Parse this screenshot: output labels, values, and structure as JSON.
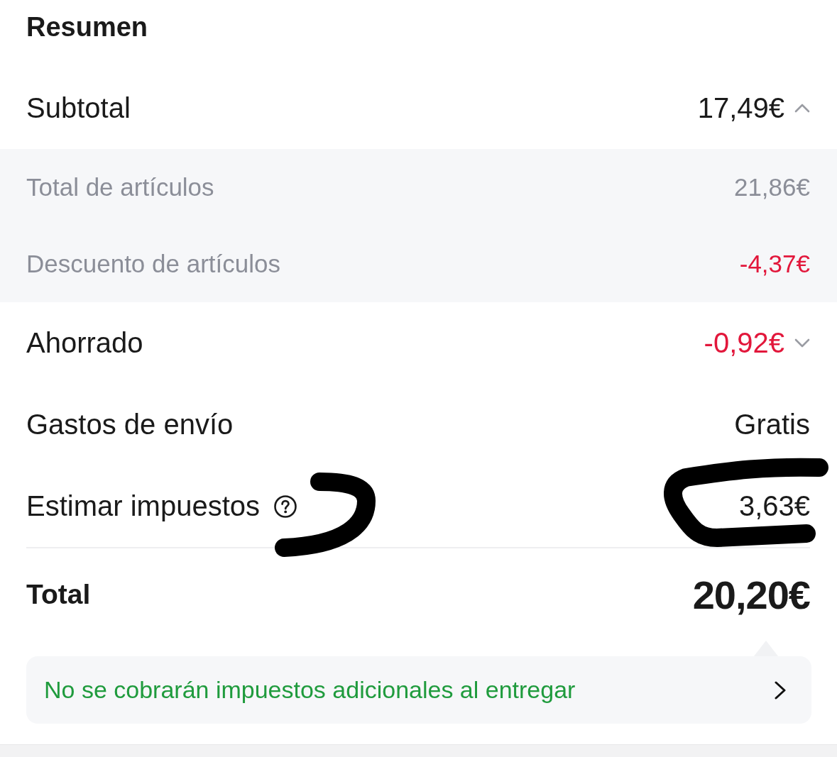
{
  "title": "Resumen",
  "rows": [
    {
      "label": "Subtotal",
      "value": "17,49€",
      "kind": "toggle",
      "expanded": true,
      "discount": false,
      "children": [
        {
          "label": "Total de artículos",
          "value": "21,86€",
          "discount": false
        },
        {
          "label": "Descuento de artículos",
          "value": "-4,37€",
          "discount": true
        }
      ]
    },
    {
      "label": "Ahorrado",
      "value": "-0,92€",
      "kind": "toggle",
      "expanded": false,
      "discount": true
    },
    {
      "label": "Gastos de envío",
      "value": "Gratis",
      "kind": "plain",
      "discount": false
    },
    {
      "label": "Estimar impuestos",
      "value": "3,63€",
      "kind": "info",
      "discount": false
    }
  ],
  "total": {
    "label": "Total",
    "value": "20,20€"
  },
  "notice": {
    "text": "No se cobrarán impuestos adicionales al entregar"
  }
}
